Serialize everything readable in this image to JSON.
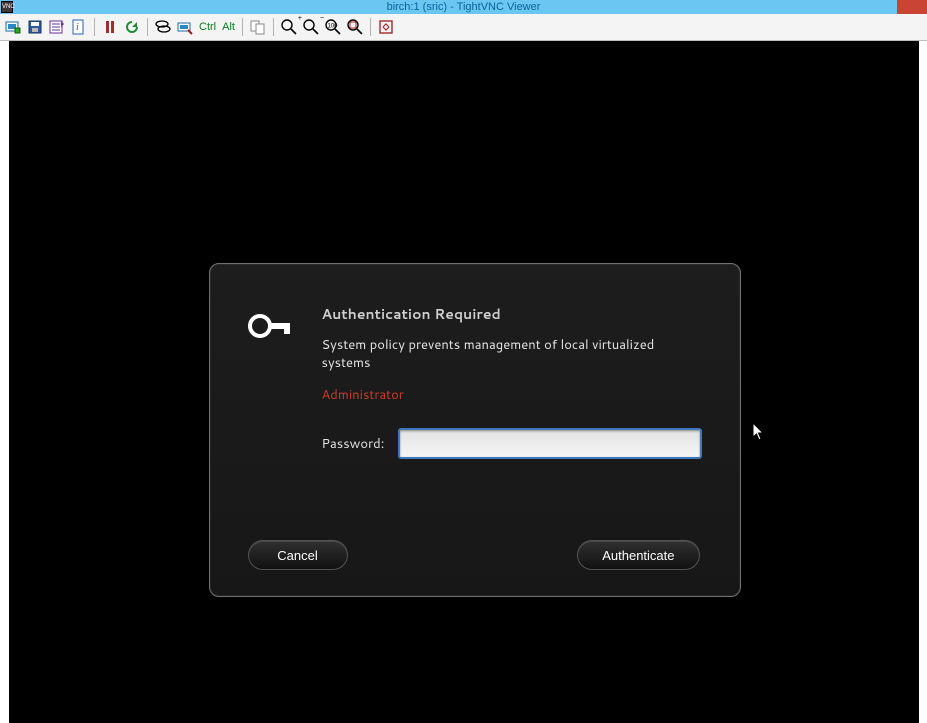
{
  "window": {
    "title": "birch:1 (sric) - TightVNC Viewer"
  },
  "toolbar": {
    "ctrl_label": "Ctrl",
    "alt_label": "Alt"
  },
  "dialog": {
    "title": "Authentication Required",
    "message": "System policy prevents management of local virtualized systems",
    "user": "Administrator",
    "password_label": "Password:",
    "password_value": "",
    "cancel_label": "Cancel",
    "authenticate_label": "Authenticate"
  }
}
